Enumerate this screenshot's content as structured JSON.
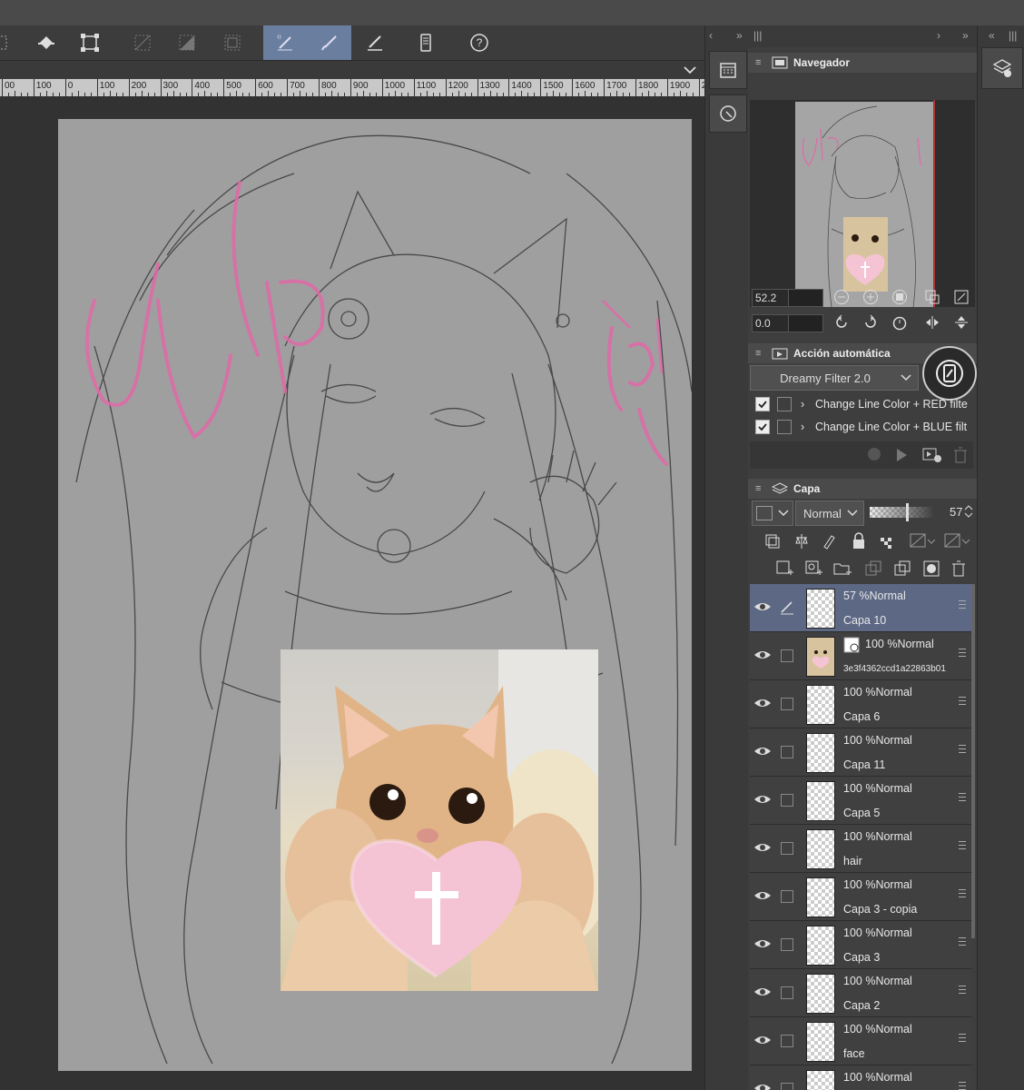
{
  "toolbar": {
    "tools": [
      {
        "name": "selection-tool"
      },
      {
        "name": "fill-tool"
      },
      {
        "name": "transform-tool"
      },
      {
        "name": "clear-outside-tool"
      },
      {
        "name": "fill-selection-tool"
      },
      {
        "name": "frame-tool"
      },
      {
        "name": "pen-tool",
        "active": true
      },
      {
        "name": "brush-tool",
        "active": true
      },
      {
        "name": "eraser-tool"
      },
      {
        "name": "device-tool"
      },
      {
        "name": "help-tool"
      }
    ]
  },
  "ruler": {
    "labels": [
      "00",
      "100",
      "0",
      "100",
      "200",
      "300",
      "400",
      "500",
      "600",
      "700",
      "800",
      "900",
      "1000",
      "1100",
      "1200",
      "1300",
      "1400",
      "1500",
      "1600",
      "1700",
      "1800",
      "1900",
      "20"
    ]
  },
  "navigator": {
    "title": "Navegador",
    "zoom": "52.2",
    "rotation": "0.0"
  },
  "auto_action": {
    "title": "Acción automática",
    "set_name": "Dreamy Filter 2.0",
    "items": [
      {
        "label": "Change Line Color +  RED filte",
        "checked": true
      },
      {
        "label": "Change Line Color + BLUE filt",
        "checked": true
      }
    ]
  },
  "layers": {
    "title": "Capa",
    "blend_mode": "Normal",
    "opacity": "57",
    "items": [
      {
        "mode": "57 %Normal",
        "name": "Capa 10",
        "selected": true,
        "thumb": "transparent"
      },
      {
        "mode": "100 %Normal",
        "name": "3e3f4362ccd1a22863b01",
        "selected": false,
        "thumb": "cat"
      },
      {
        "mode": "100 %Normal",
        "name": "Capa 6",
        "selected": false,
        "thumb": "transparent"
      },
      {
        "mode": "100 %Normal",
        "name": "Capa 11",
        "selected": false,
        "thumb": "transparent"
      },
      {
        "mode": "100 %Normal",
        "name": "Capa 5",
        "selected": false,
        "thumb": "transparent"
      },
      {
        "mode": "100 %Normal",
        "name": "hair",
        "selected": false,
        "thumb": "transparent"
      },
      {
        "mode": "100 %Normal",
        "name": "Capa 3 - copia",
        "selected": false,
        "thumb": "transparent"
      },
      {
        "mode": "100 %Normal",
        "name": "Capa 3",
        "selected": false,
        "thumb": "transparent"
      },
      {
        "mode": "100 %Normal",
        "name": "Capa 2",
        "selected": false,
        "thumb": "transparent"
      },
      {
        "mode": "100 %Normal",
        "name": "face",
        "selected": false,
        "thumb": "transparent"
      },
      {
        "mode": "100 %Normal",
        "name": "",
        "selected": false,
        "thumb": "transparent"
      }
    ]
  },
  "canvas": {
    "wip_text": "WIP",
    "side_text": "lost day",
    "colors": {
      "paper": "#9f9f9f",
      "sketch": "#3a3a3a",
      "wip": "#e06aa8",
      "heart": "#f5c4d4"
    }
  }
}
